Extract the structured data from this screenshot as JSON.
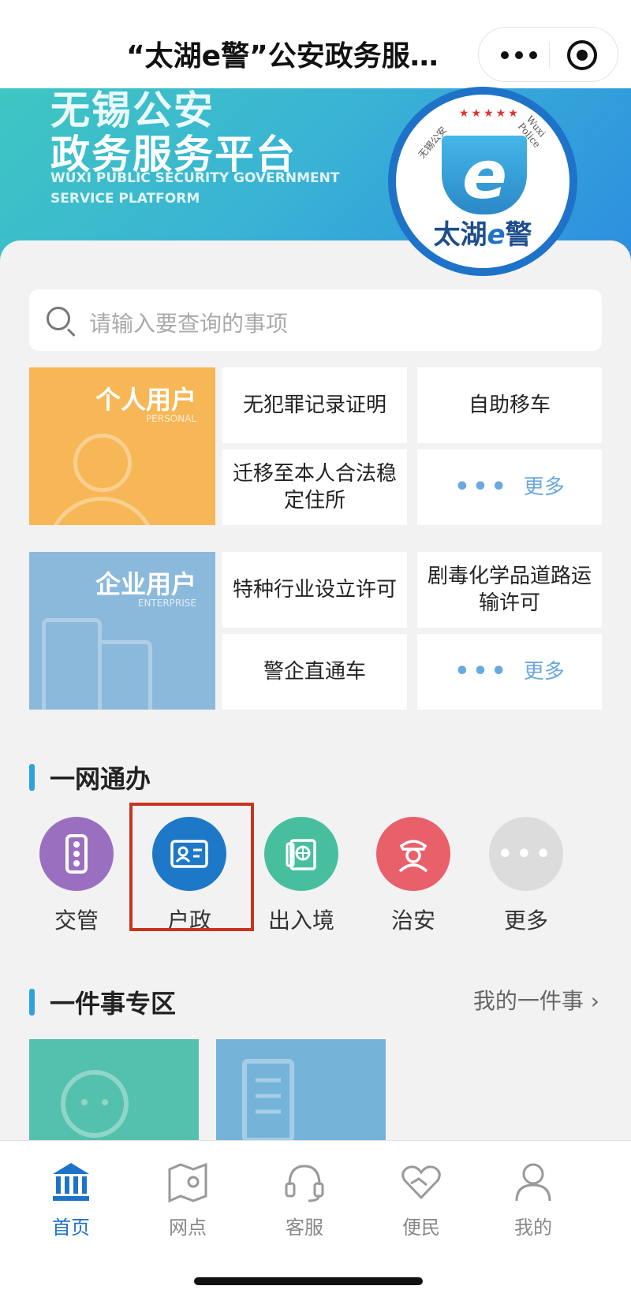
{
  "header": {
    "title": "“太湖e警”公安政务服…"
  },
  "banner": {
    "title_line1": "无锡公安",
    "title_line2": "政务服务平台",
    "subtitle_line1": "WUXI PUBLIC SECURITY GOVERNMENT",
    "subtitle_line2": "SERVICE PLATFORM",
    "logo": {
      "text_left": "无锡公安",
      "text_right": "Wuxi Police",
      "stars": "★★★★★",
      "brand_a": "太湖",
      "brand_b": "e",
      "brand_c": "警"
    }
  },
  "search": {
    "placeholder": "请输入要查询的事项"
  },
  "personal": {
    "label": "个人用户",
    "sub": "PERSONAL",
    "items": [
      "无犯罪记录证明",
      "自助移车",
      "迁移至本人合法稳定住所",
      "更多"
    ]
  },
  "enterprise": {
    "label": "企业用户",
    "sub": "ENTERPRISE",
    "items": [
      "特种行业设立许可",
      "剧毒化学品道路运输许可",
      "警企直通车",
      "更多"
    ]
  },
  "section_one_net": {
    "title": "一网通办",
    "items": [
      {
        "label": "交管",
        "icon": "traffic-light-icon",
        "color": "#9b6fc0"
      },
      {
        "label": "户政",
        "icon": "id-card-icon",
        "color": "#1e78c8"
      },
      {
        "label": "出入境",
        "icon": "passport-icon",
        "color": "#47bf9f"
      },
      {
        "label": "治安",
        "icon": "police-officer-icon",
        "color": "#e8606a"
      },
      {
        "label": "更多",
        "icon": "more-dots-icon",
        "color": "#dcdcdc"
      }
    ]
  },
  "section_one_thing": {
    "title": "一件事专区",
    "link": "我的一件事"
  },
  "tabbar": {
    "items": [
      {
        "label": "首页",
        "icon": "bank-building-icon",
        "active": true
      },
      {
        "label": "网点",
        "icon": "map-pin-icon",
        "active": false
      },
      {
        "label": "客服",
        "icon": "headset-icon",
        "active": false
      },
      {
        "label": "便民",
        "icon": "heart-hands-icon",
        "active": false
      },
      {
        "label": "我的",
        "icon": "user-icon",
        "active": false
      }
    ]
  }
}
